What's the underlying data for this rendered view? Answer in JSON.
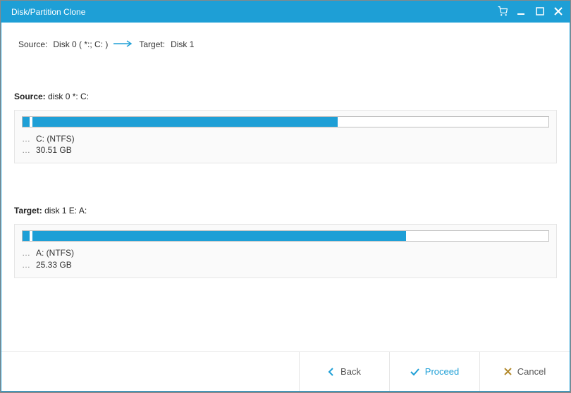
{
  "window": {
    "title": "Disk/Partition Clone"
  },
  "path": {
    "source_label": "Source:",
    "source_value": "Disk 0 ( *:; C: )",
    "target_label": "Target:",
    "target_value": "Disk 1"
  },
  "source_section": {
    "label_prefix": "Source:",
    "label_value": "disk 0 *: C:",
    "partition_label": "C: (NTFS)",
    "partition_size": "30.51 GB",
    "small_seg_pct": 1.5,
    "main_seg_pct": 58
  },
  "target_section": {
    "label_prefix": "Target:",
    "label_value": "disk 1 E: A:",
    "partition_label": "A: (NTFS)",
    "partition_size": "25.33 GB",
    "small_seg_pct": 1.5,
    "main_seg_pct": 71
  },
  "footer": {
    "back": "Back",
    "proceed": "Proceed",
    "cancel": "Cancel"
  }
}
